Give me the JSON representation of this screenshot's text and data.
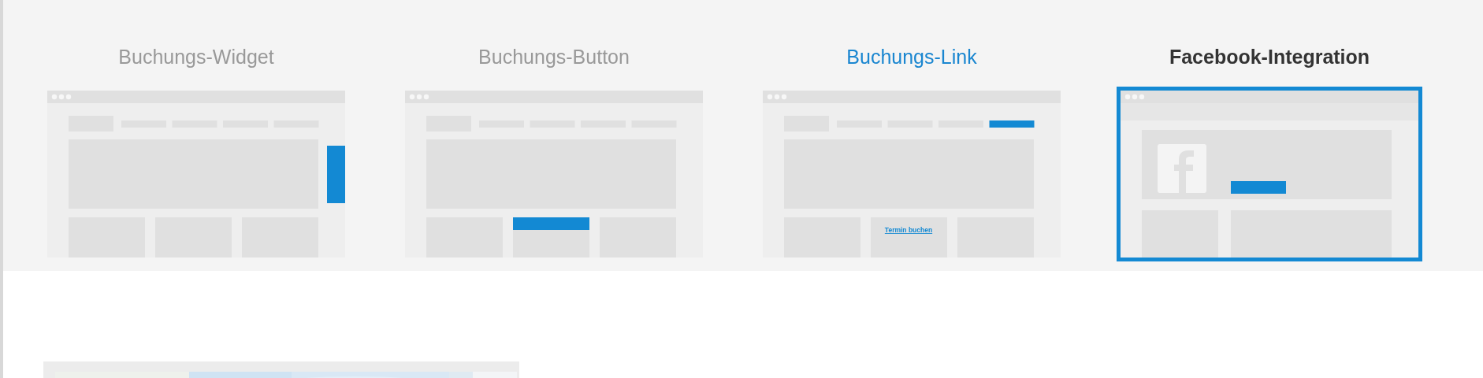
{
  "options": [
    {
      "title": "Buchungs-Widget",
      "selected": false,
      "highlighted": false,
      "kind": "widget"
    },
    {
      "title": "Buchungs-Button",
      "selected": false,
      "highlighted": false,
      "kind": "button"
    },
    {
      "title": "Buchungs-Link",
      "selected": false,
      "highlighted": true,
      "kind": "link",
      "link_text": "Termin buchen"
    },
    {
      "title": "Facebook-Integration",
      "selected": true,
      "highlighted": false,
      "kind": "facebook"
    }
  ]
}
